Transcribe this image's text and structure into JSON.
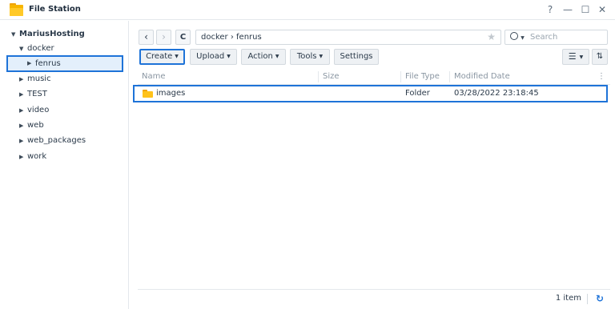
{
  "window": {
    "title": "File Station",
    "help": "?",
    "minimize": "—",
    "maximize": "☐",
    "close": "✕"
  },
  "sidebar": {
    "root": "MariusHosting",
    "items": [
      {
        "label": "docker",
        "expanded": true
      },
      {
        "label": "fenrus",
        "selected": true
      },
      {
        "label": "music"
      },
      {
        "label": "TEST"
      },
      {
        "label": "video"
      },
      {
        "label": "web"
      },
      {
        "label": "web_packages"
      },
      {
        "label": "work"
      }
    ]
  },
  "toolbar": {
    "back": "‹",
    "forward": "›",
    "refresh": "C",
    "path": "docker › fenrus",
    "favorite_icon": "star-icon",
    "search_placeholder": "Search",
    "buttons": {
      "create": "Create",
      "upload": "Upload",
      "action": "Action",
      "tools": "Tools",
      "settings": "Settings"
    }
  },
  "table": {
    "columns": [
      "Name",
      "Size",
      "File Type",
      "Modified Date"
    ],
    "rows": [
      {
        "name": "images",
        "size": "",
        "type": "Folder",
        "modified": "03/28/2022 23:18:45"
      }
    ]
  },
  "footer": {
    "count": "1 item"
  },
  "colors": {
    "accent": "#1e73d8",
    "folder": "#ffc21a",
    "button_bg": "#eef1f4"
  }
}
